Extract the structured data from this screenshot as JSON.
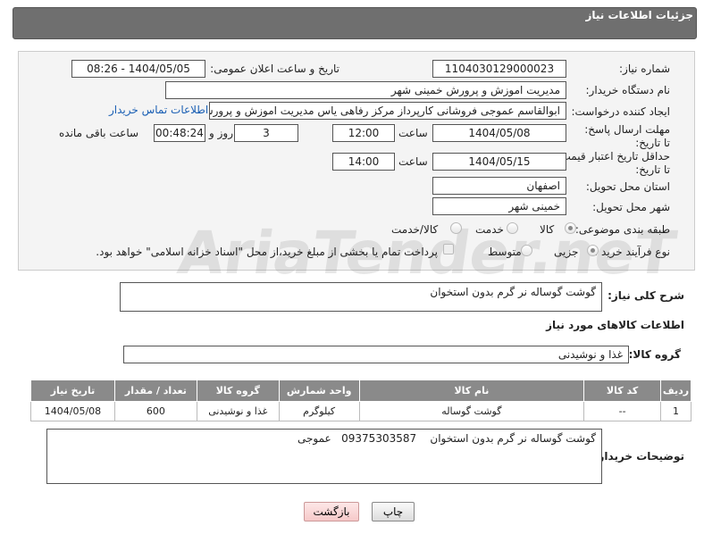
{
  "header": {
    "title": "جزئیات اطلاعات نیاز"
  },
  "form": {
    "need_number_label": "شماره نیاز:",
    "need_number": "1104030129000023",
    "announce_label": "تاریخ و ساعت اعلان عمومی:",
    "announce_value": "1404/05/05 - 08:26",
    "buyer_org_label": "نام دستگاه خریدار:",
    "buyer_org": "مدیریت اموزش و پرورش خمینی شهر",
    "creator_label": "ایجاد کننده درخواست:",
    "creator": "ابوالقاسم عموجی فروشانی کارپرداز مرکز رفاهی یاس مدیریت اموزش و پرورش خ",
    "contact_link": "اطلاعات تماس خریدار",
    "deadline_label": "مهلت ارسال پاسخ: تا تاریخ:",
    "deadline_date": "1404/05/08",
    "time_label": "ساعت",
    "deadline_time": "12:00",
    "days_value": "3",
    "days_label": "روز و",
    "remaining_time": "00:48:24",
    "remaining_label": "ساعت باقی مانده",
    "price_valid_label": "حداقل تاریخ اعتبار قیمت: تا تاریخ:",
    "price_valid_date": "1404/05/15",
    "price_valid_time": "14:00",
    "province_label": "استان محل تحویل:",
    "province": "اصفهان",
    "city_label": "شهر محل تحویل:",
    "city": "خمینی شهر",
    "category_label": "طبقه بندی موضوعی:",
    "category_options": [
      "کالا",
      "خدمت",
      "کالا/خدمت"
    ],
    "category_selected": "کالا",
    "process_label": "نوع فرآیند خرید :",
    "process_options": [
      "جزیی",
      "متوسط"
    ],
    "process_selected": "جزیی",
    "payment_note": "پرداخت تمام یا بخشی از مبلغ خرید،از محل \"اسناد خزانه اسلامی\" خواهد بود."
  },
  "watermark": "AriaTender.neT",
  "description": {
    "label": "شرح کلی نیاز:",
    "value": "گوشت گوساله نر گرم بدون استخوان"
  },
  "goods_info": {
    "title": "اطلاعات کالاهای مورد نیاز",
    "group_label": "گروه کالا:",
    "group_value": "غذا و نوشیدنی",
    "columns": [
      "ردیف",
      "کد کالا",
      "نام کالا",
      "واحد شمارش",
      "گروه کالا",
      "تعداد / مقدار",
      "تاریخ نیاز"
    ],
    "rows": [
      [
        "1",
        "--",
        "گوشت گوساله",
        "کیلوگرم",
        "غذا و نوشیدنی",
        "600",
        "1404/05/08"
      ]
    ]
  },
  "buyer_notes": {
    "label": "توضیحات خریدار:",
    "value": "گوشت گوساله نر گرم بدون استخوان    09375303587   عموجی"
  },
  "buttons": {
    "print": "چاپ",
    "back": "بازگشت"
  }
}
